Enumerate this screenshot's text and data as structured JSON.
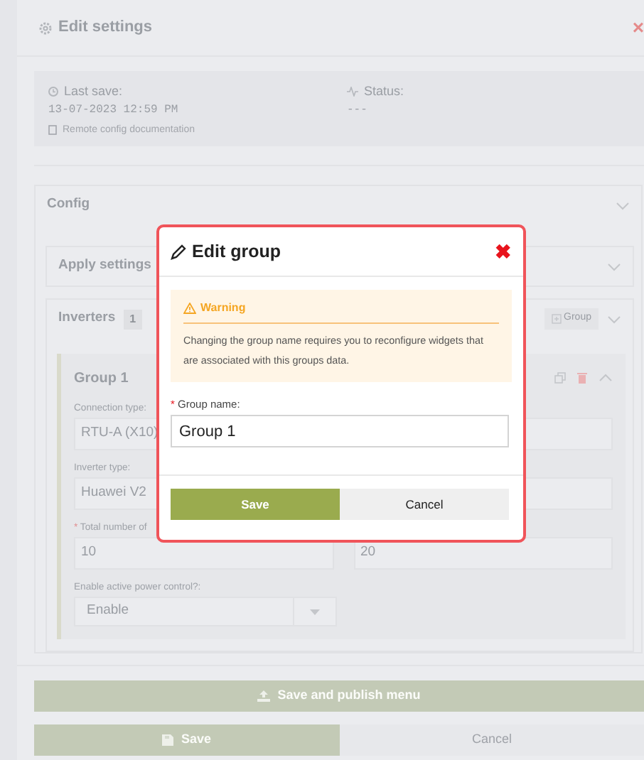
{
  "settings": {
    "title": "Edit settings",
    "last_save_label": "Last save:",
    "last_save_value": "13-07-2023 12:59 PM",
    "doc_link": "Remote config documentation",
    "status_label": "Status:",
    "status_value": "---",
    "close_glyph": "×"
  },
  "config": {
    "title": "Config",
    "apply_title": "Apply settings",
    "inverters_title": "Inverters",
    "inverters_count": "1",
    "add_group_button": "Group"
  },
  "group_card": {
    "title": "Group 1",
    "rows": [
      {
        "label": "Connection type:",
        "mark": "",
        "left_value": "RTU-A (X10)",
        "right_value": ""
      },
      {
        "label": "Inverter type:",
        "mark": "",
        "left_value": "Huawei V2",
        "right_value": ""
      },
      {
        "label": "Total number of",
        "mark": "*",
        "left_value": "10",
        "right_value": "20"
      }
    ],
    "select": {
      "label": "Enable active power control?:",
      "value": "Enable"
    }
  },
  "footer": {
    "publish_button": "Save and publish menu",
    "save_button": "Save",
    "cancel_button": "Cancel"
  },
  "modal": {
    "title": "Edit group",
    "close_glyph": "✖",
    "warning_title": "Warning",
    "warning_text": "Changing the group name requires you to reconfigure widgets that are associated with this groups data.",
    "field_mark": "*",
    "field_label": "Group name:",
    "field_value": "Group 1",
    "save_button": "Save",
    "cancel_button": "Cancel"
  }
}
